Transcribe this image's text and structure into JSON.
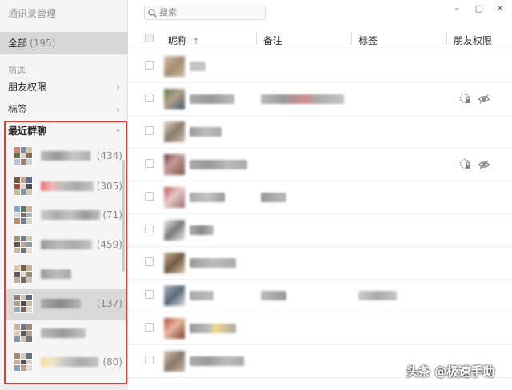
{
  "app": {
    "title": "通讯录管理"
  },
  "sidebar": {
    "all_label": "全部",
    "all_count": "(195)",
    "filter_heading": "筛选",
    "items": [
      {
        "label": "朋友权限"
      },
      {
        "label": "标签"
      }
    ],
    "recent_groups_label": "最近群聊",
    "groups": [
      {
        "count": "(434)"
      },
      {
        "count": "(305)"
      },
      {
        "count": "(71)"
      },
      {
        "count": "(459)"
      },
      {
        "count": ""
      },
      {
        "count": "(137)"
      },
      {
        "count": ""
      },
      {
        "count": "(80)"
      }
    ]
  },
  "search": {
    "placeholder": "搜索"
  },
  "window": {
    "minimize": "–",
    "maximize": "□",
    "close": "✕"
  },
  "table": {
    "columns": {
      "nickname": "昵称",
      "sort_arrow": "↑",
      "remark": "备注",
      "tags": "标签",
      "permissions": "朋友权限"
    }
  },
  "icons": {
    "search": "search-icon",
    "chevron": "chevron-right-icon",
    "lock": "lock-icon",
    "eye": "eye-off-icon"
  },
  "colors": {
    "highlight_border": "#e53935",
    "selected": "#d7d7d7"
  },
  "watermark": "头条 @极速手助"
}
